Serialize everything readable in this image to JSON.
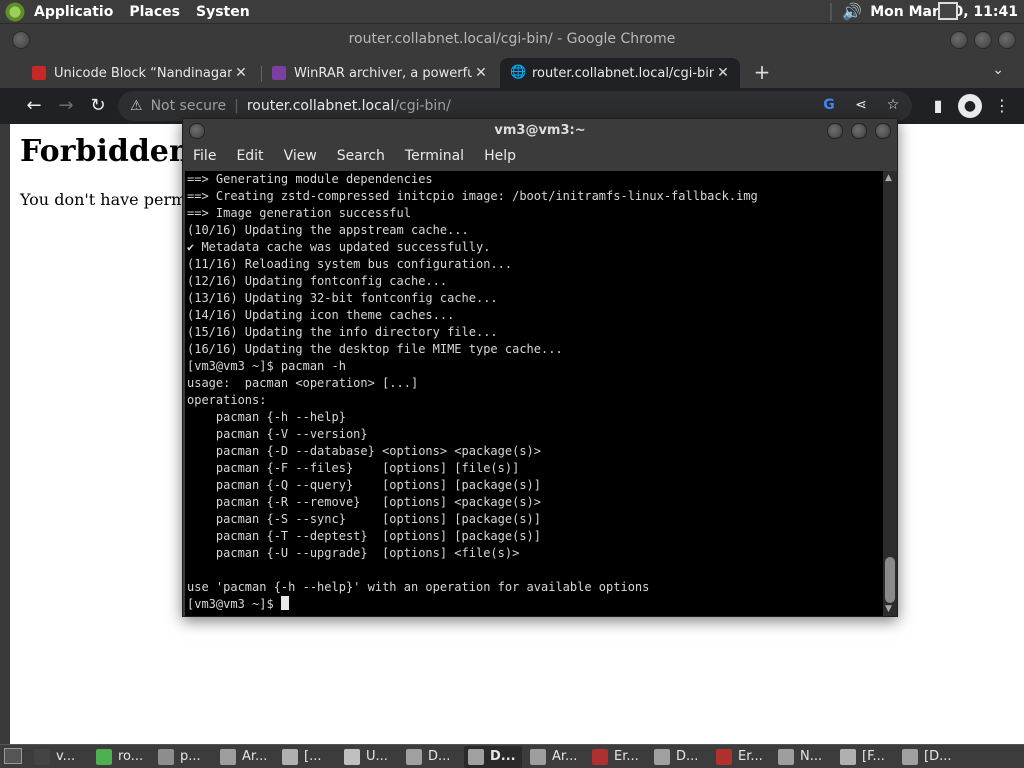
{
  "top_panel": {
    "menus": [
      "Applicatio",
      "Places",
      "Systen"
    ],
    "clock": "Mon Mar 20, 11:41",
    "volume_icon": "speaker-icon"
  },
  "chrome": {
    "window_title": "router.collabnet.local/cgi-bin/ - Google Chrome",
    "tabs": [
      {
        "title": "Unicode Block “Nandinagari”",
        "favicon": "unicode-favicon-icon",
        "color": "#c62828"
      },
      {
        "title": "WinRAR archiver, a powerful t",
        "favicon": "winrar-favicon-icon",
        "color": "#7b3fa0"
      },
      {
        "title": "router.collabnet.local/cgi-bin/",
        "favicon": "globe-icon",
        "color": "#bdc1c6"
      }
    ],
    "new_tab": "+",
    "tab_menu": "⌄",
    "address": {
      "security": "Not secure",
      "host": "router.collabnet.local",
      "path": "/cgi-bin/"
    },
    "page": {
      "heading": "Forbidden",
      "message": "You don't have permissio"
    }
  },
  "terminal": {
    "title": "vm3@vm3:~",
    "menu": [
      "File",
      "Edit",
      "View",
      "Search",
      "Terminal",
      "Help"
    ],
    "lines": [
      "==> Generating module dependencies",
      "==> Creating zstd-compressed initcpio image: /boot/initramfs-linux-fallback.img",
      "==> Image generation successful",
      "(10/16) Updating the appstream cache...",
      "✔ Metadata cache was updated successfully.",
      "(11/16) Reloading system bus configuration...",
      "(12/16) Updating fontconfig cache...",
      "(13/16) Updating 32-bit fontconfig cache...",
      "(14/16) Updating icon theme caches...",
      "(15/16) Updating the info directory file...",
      "(16/16) Updating the desktop file MIME type cache...",
      "[vm3@vm3 ~]$ pacman -h",
      "usage:  pacman <operation> [...]",
      "operations:",
      "    pacman {-h --help}",
      "    pacman {-V --version}",
      "    pacman {-D --database} <options> <package(s)>",
      "    pacman {-F --files}    [options] [file(s)]",
      "    pacman {-Q --query}    [options] [package(s)]",
      "    pacman {-R --remove}   [options] <package(s)>",
      "    pacman {-S --sync}     [options] [package(s)]",
      "    pacman {-T --deptest}  [options] [package(s)]",
      "    pacman {-U --upgrade}  [options] <file(s)>",
      "",
      "use 'pacman {-h --help}' with an operation for available options"
    ],
    "prompt": "[vm3@vm3 ~]$ "
  },
  "taskbar": {
    "items": [
      {
        "label": "v...",
        "icon": "terminal-icon",
        "color": "#444444"
      },
      {
        "label": "ro...",
        "icon": "chrome-icon",
        "color": "#4caf50"
      },
      {
        "label": "p...",
        "icon": "file-manager-icon",
        "color": "#8d8d8d"
      },
      {
        "label": "Ar...",
        "icon": "archive-icon",
        "color": "#9e9e9e"
      },
      {
        "label": "[...",
        "icon": "document-icon",
        "color": "#b0b0b0"
      },
      {
        "label": "U...",
        "icon": "text-file-icon",
        "color": "#c0c0c0"
      },
      {
        "label": "D...",
        "icon": "folder-icon",
        "color": "#a0a0a0"
      },
      {
        "label": "D...",
        "icon": "folder-icon",
        "color": "#a0a0a0"
      },
      {
        "label": "Ar...",
        "icon": "archive-icon",
        "color": "#9e9e9e"
      },
      {
        "label": "Er...",
        "icon": "wine-icon",
        "color": "#b03030"
      },
      {
        "label": "D...",
        "icon": "folder-icon",
        "color": "#a0a0a0"
      },
      {
        "label": "Er...",
        "icon": "wine-icon",
        "color": "#b03030"
      },
      {
        "label": "N...",
        "icon": "archive-icon",
        "color": "#9e9e9e"
      },
      {
        "label": "[F...",
        "icon": "font-viewer-icon",
        "color": "#b0b0b0"
      },
      {
        "label": "[D...",
        "icon": "folder-icon",
        "color": "#a0a0a0"
      }
    ],
    "active_index": 7
  }
}
